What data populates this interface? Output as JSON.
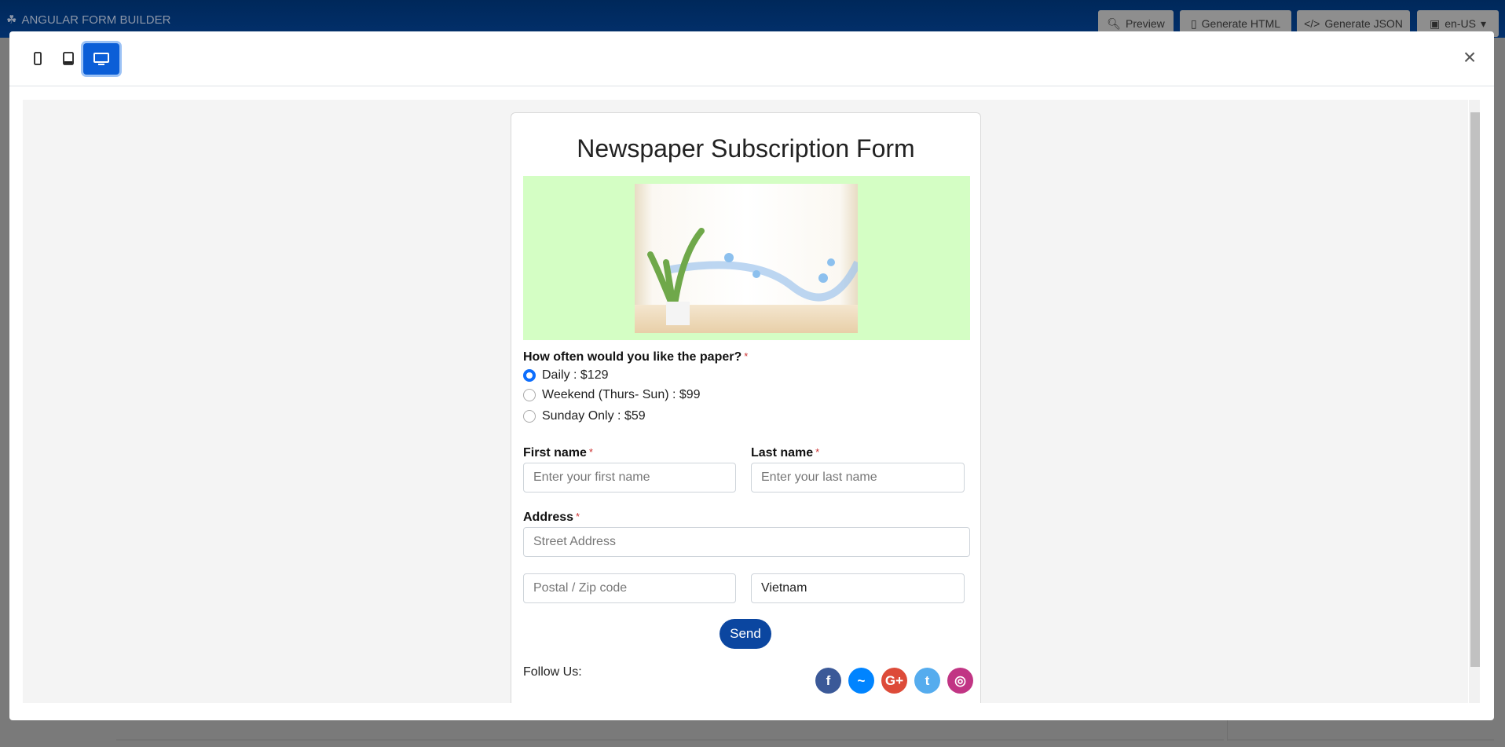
{
  "app": {
    "title": "ANGULAR FORM BUILDER"
  },
  "toolbar": {
    "preview": "Preview",
    "generate_html": "Generate HTML",
    "generate_json": "Generate JSON",
    "language": "en-US"
  },
  "modal": {
    "devices": [
      "mobile",
      "tablet",
      "desktop"
    ],
    "active_device": "desktop",
    "close": "×"
  },
  "form": {
    "title": "Newspaper Subscription Form",
    "question": "How often would you like the paper?",
    "required_mark": "*",
    "options": [
      {
        "label": "Daily : $129",
        "checked": true
      },
      {
        "label": "Weekend (Thurs- Sun) : $99",
        "checked": false
      },
      {
        "label": "Sunday Only : $59",
        "checked": false
      }
    ],
    "first_name": {
      "label": "First name",
      "placeholder": "Enter your first name"
    },
    "last_name": {
      "label": "Last name",
      "placeholder": "Enter your last name"
    },
    "address": {
      "label": "Address",
      "placeholder": "Street Address"
    },
    "postal": {
      "placeholder": "Postal / Zip code"
    },
    "country": {
      "value": "Vietnam"
    },
    "send": "Send",
    "follow": "Follow Us:",
    "social": [
      {
        "name": "facebook",
        "glyph": "f",
        "color": "#3b5998"
      },
      {
        "name": "messenger",
        "glyph": "~",
        "color": "#0084ff"
      },
      {
        "name": "google-plus",
        "glyph": "G+",
        "color": "#dd4b39"
      },
      {
        "name": "twitter",
        "glyph": "t",
        "color": "#55acee"
      },
      {
        "name": "instagram",
        "glyph": "◎",
        "color": "#c13584"
      }
    ]
  }
}
